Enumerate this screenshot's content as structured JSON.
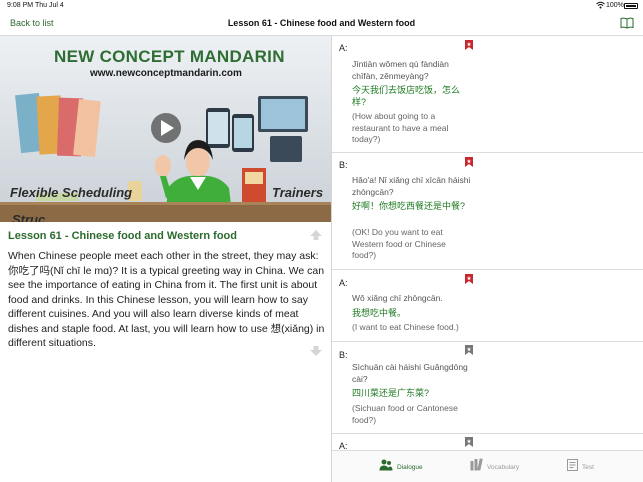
{
  "status_bar": {
    "time": "9:08 PM",
    "date": "Thu Jul 4",
    "battery": "100%"
  },
  "nav": {
    "back_label": "Back to list",
    "title": "Lesson 61 - Chinese food and Western food"
  },
  "video": {
    "brand_title": "NEW CONCEPT MANDARIN",
    "brand_url": "www.newconceptmandarin.com",
    "banner_left": "Flexible Scheduling",
    "banner_right": "Trainers",
    "banner_cut": "Struc"
  },
  "lesson": {
    "title": "Lesson 61 - Chinese food and Western food",
    "description": "When Chinese people meet each other in the street, they may ask: 你吃了吗(Nǐ chī le mɑ)? It is a typical greeting way in China. We can see the importance of eating in China from it. The first unit is about food and drinks. In this Chinese lesson, you will learn how to say different cuisines. And you will also learn diverse kinds of meat dishes and staple food. At last, you will learn how to use 想(xiǎng) in different situations."
  },
  "dialogue": [
    {
      "speaker": "A:",
      "pinyin": "Jīntiān wǒmen qù fàndiàn chīfàn, zěnmeyàng?",
      "hanzi": "今天我们去饭店吃饭，怎么样?",
      "english": "(How about going to a restaurant to have a meal today?)",
      "bookmarked": true
    },
    {
      "speaker": "B:",
      "pinyin": "Hǎo'a! Nǐ xiǎng chī xīcān háishi zhōngcān?",
      "hanzi": "好啊！你想吃西餐还是中餐?",
      "english": "(OK! Do you want to eat Western food or Chinese food?)",
      "bookmarked": true
    },
    {
      "speaker": "A:",
      "pinyin": "Wǒ xiǎng chī zhōngcān.",
      "hanzi": "我想吃中餐。",
      "english": "(I want to eat Chinese food.)",
      "bookmarked": true
    },
    {
      "speaker": "B:",
      "pinyin": "Sìchuān cài háishi Guǎngdōng cài?",
      "hanzi": "四川菜还是广东菜?",
      "english": "(Sichuan food or Cantonese food?)",
      "bookmarked": false
    },
    {
      "speaker": "A:",
      "pinyin": "",
      "hanzi": "",
      "english": "",
      "bookmarked": false
    }
  ],
  "tabs": {
    "dialogue": "Dialogue",
    "vocabulary": "Vocabulary",
    "test": "Test"
  },
  "colors": {
    "accent_green": "#2b6b2e",
    "hanzi_green": "#1f7a22",
    "bookmark_red": "#c8282d",
    "bookmark_gray": "#777777",
    "inactive_gray": "#9a9a9a"
  },
  "icons": {
    "book": "book-open-icon",
    "play": "play-icon",
    "bookmark": "bookmark-icon",
    "dialogue_tab": "people-icon",
    "vocabulary_tab": "books-icon",
    "test_tab": "document-icon",
    "scroll_up": "arrow-up-icon",
    "scroll_down": "arrow-down-icon"
  }
}
